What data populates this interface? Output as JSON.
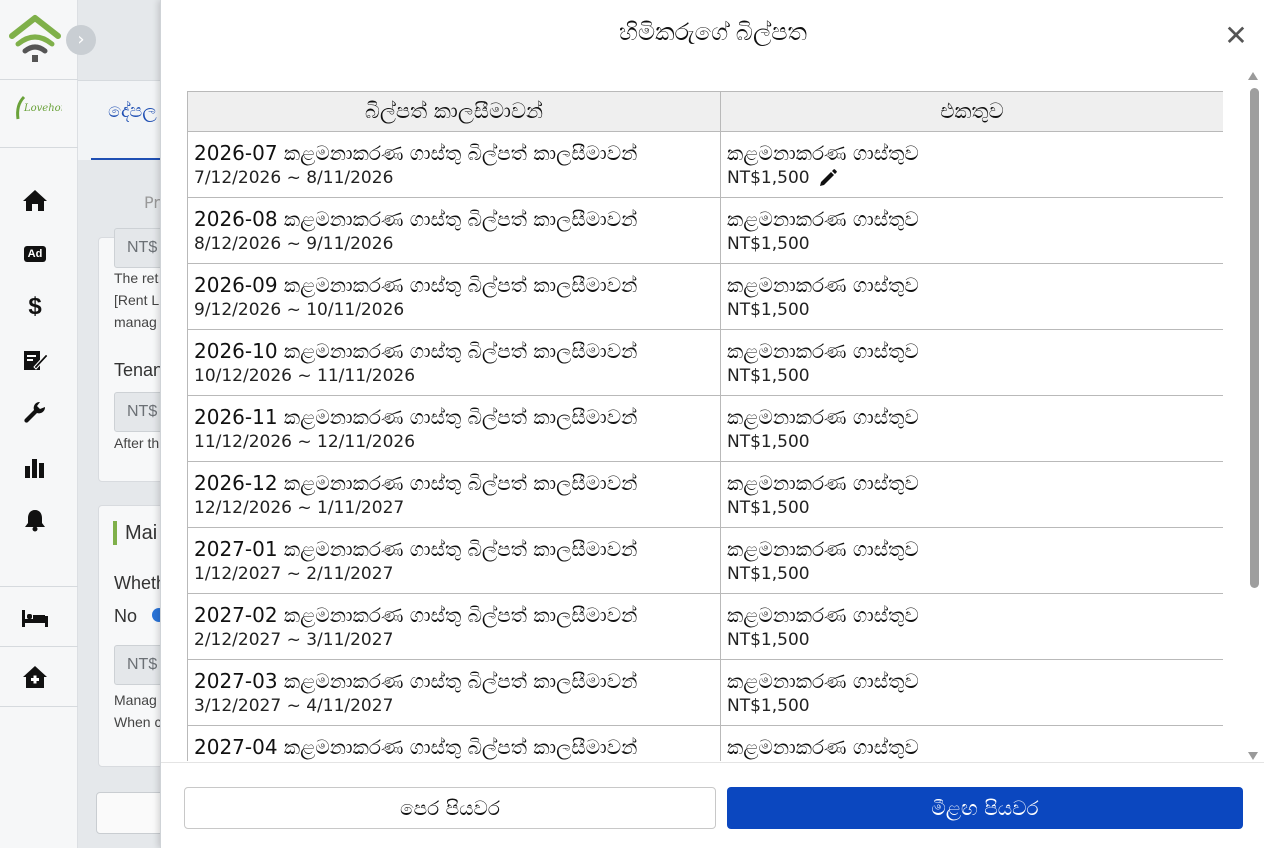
{
  "background": {
    "tab_label": "දේපල",
    "subtab_label": "Pr",
    "card1": {
      "field_prefix": "NT$",
      "line1": "The ret",
      "line2": "[Rent L",
      "line3": "manag",
      "tenant_label": "Tenan",
      "field2_prefix": "NT$",
      "after_text": "After th"
    },
    "card2": {
      "section_title": "Mai",
      "whether_label": "Wheth",
      "no_label": "No",
      "field_prefix": "NT$",
      "manage_text": "Manag",
      "when_text": "When c"
    }
  },
  "sidebar": {
    "icons": [
      "home-icon",
      "ad-icon",
      "dollar-icon",
      "contract-icon",
      "wrench-icon",
      "chart-icon",
      "bell-icon",
      "bed-icon",
      "house-icon"
    ],
    "ad_text": "Ad",
    "dollar_text": "$"
  },
  "modal": {
    "title": "හිමිකරුගේ බිල්පත",
    "close_symbol": "✕",
    "columns": [
      "බිල්පත් කාලසීමාවන්",
      "එකතුව"
    ],
    "rows": [
      {
        "period": "2026-07 කළමනාකරණ ගාස්තු බිල්පත් කාලසීමාවන්",
        "dates": "7/12/2026 ~ 8/11/2026",
        "fee": "කළමනාකරණ ගාස්තුව",
        "amount": "NT$1,500",
        "editable": true
      },
      {
        "period": "2026-08 කළමනාකරණ ගාස්තු බිල්පත් කාලසීමාවන්",
        "dates": "8/12/2026 ~ 9/11/2026",
        "fee": "කළමනාකරණ ගාස්තුව",
        "amount": "NT$1,500"
      },
      {
        "period": "2026-09 කළමනාකරණ ගාස්තු බිල්පත් කාලසීමාවන්",
        "dates": "9/12/2026 ~ 10/11/2026",
        "fee": "කළමනාකරණ ගාස්තුව",
        "amount": "NT$1,500"
      },
      {
        "period": "2026-10 කළමනාකරණ ගාස්තු බිල්පත් කාලසීමාවන්",
        "dates": "10/12/2026 ~ 11/11/2026",
        "fee": "කළමනාකරණ ගාස්තුව",
        "amount": "NT$1,500"
      },
      {
        "period": "2026-11 කළමනාකරණ ගාස්තු බිල්පත් කාලසීමාවන්",
        "dates": "11/12/2026 ~ 12/11/2026",
        "fee": "කළමනාකරණ ගාස්තුව",
        "amount": "NT$1,500"
      },
      {
        "period": "2026-12 කළමනාකරණ ගාස්තු බිල්පත් කාලසීමාවන්",
        "dates": "12/12/2026 ~ 1/11/2027",
        "fee": "කළමනාකරණ ගාස්තුව",
        "amount": "NT$1,500"
      },
      {
        "period": "2027-01 කළමනාකරණ ගාස්තු බිල්පත් කාලසීමාවන්",
        "dates": "1/12/2027 ~ 2/11/2027",
        "fee": "කළමනාකරණ ගාස්තුව",
        "amount": "NT$1,500"
      },
      {
        "period": "2027-02 කළමනාකරණ ගාස්තු බිල්පත් කාලසීමාවන්",
        "dates": "2/12/2027 ~ 3/11/2027",
        "fee": "කළමනාකරණ ගාස්තුව",
        "amount": "NT$1,500"
      },
      {
        "period": "2027-03 කළමනාකරණ ගාස්තු බිල්පත් කාලසීමාවන්",
        "dates": "3/12/2027 ~ 4/11/2027",
        "fee": "කළමනාකරණ ගාස්තුව",
        "amount": "NT$1,500"
      },
      {
        "period": "2027-04 කළමනාකරණ ගාස්තු බිල්පත් කාලසීමාවන්",
        "dates": "",
        "fee": "කළමනාකරණ ගාස්තුව",
        "amount": ""
      }
    ],
    "footer": {
      "prev_label": "පෙර පියවර",
      "next_label": "මීළඟ පියවර"
    }
  },
  "colors": {
    "accent_blue": "#0b47bf",
    "link_blue": "#1f4fb3",
    "brand_green": "#7fb04a"
  }
}
